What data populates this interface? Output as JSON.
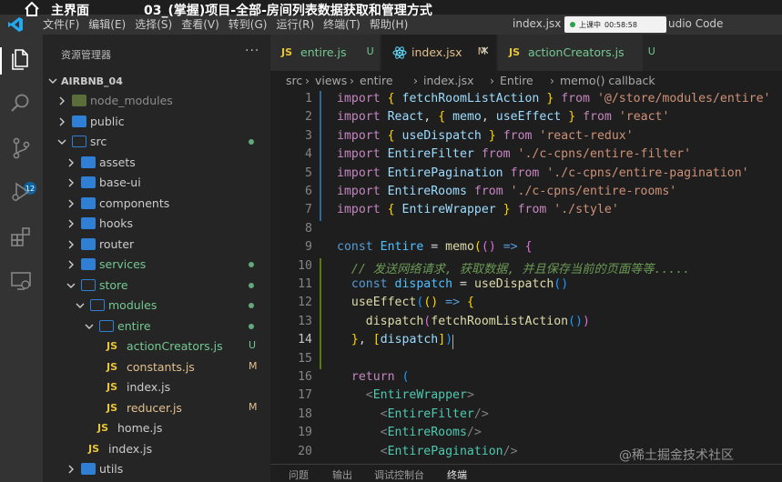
{
  "overlay": {
    "home_label": "主界面",
    "lesson_title": "03_(掌握)项目-全部-房间列表数据获取和管理方式"
  },
  "menu": [
    "文件(F)",
    "编辑(E)",
    "选择(S)",
    "查看(V)",
    "转到(G)",
    "运行(R)",
    "终端(T)",
    "帮助(H)"
  ],
  "window": {
    "title": "index.jsx - ",
    "title_suffix": "udio Code",
    "meeting_label": "上课中",
    "meeting_time": "00:58:58"
  },
  "activity": {
    "scm_badge": "12",
    "icons": [
      "files-icon",
      "search-icon",
      "source-control-icon",
      "run-debug-icon",
      "extensions-icon",
      "remote-explorer-icon"
    ]
  },
  "explorer": {
    "header": "资源管理器",
    "more": "···",
    "root": "AIRBNB_04",
    "tree": [
      {
        "name": "node_modules",
        "type": "folder",
        "depth": 1,
        "open": false,
        "status": "",
        "dim": true
      },
      {
        "name": "public",
        "type": "folder",
        "depth": 1,
        "open": false,
        "status": ""
      },
      {
        "name": "src",
        "type": "folder",
        "depth": 1,
        "open": true,
        "status": "dot"
      },
      {
        "name": "assets",
        "type": "folder",
        "depth": 2,
        "open": false,
        "status": ""
      },
      {
        "name": "base-ui",
        "type": "folder",
        "depth": 2,
        "open": false,
        "status": ""
      },
      {
        "name": "components",
        "type": "folder",
        "depth": 2,
        "open": false,
        "status": ""
      },
      {
        "name": "hooks",
        "type": "folder",
        "depth": 2,
        "open": false,
        "status": ""
      },
      {
        "name": "router",
        "type": "folder",
        "depth": 2,
        "open": false,
        "status": ""
      },
      {
        "name": "services",
        "type": "folder",
        "depth": 2,
        "open": false,
        "status": "dot",
        "color": "green"
      },
      {
        "name": "store",
        "type": "folder",
        "depth": 2,
        "open": true,
        "status": "dot",
        "color": "green"
      },
      {
        "name": "modules",
        "type": "folder",
        "depth": 3,
        "open": true,
        "status": "dot",
        "color": "green"
      },
      {
        "name": "entire",
        "type": "folder",
        "depth": 4,
        "open": true,
        "status": "dot",
        "color": "green"
      },
      {
        "name": "actionCreators.js",
        "type": "js",
        "depth": 5,
        "status": "U",
        "color": "green"
      },
      {
        "name": "constants.js",
        "type": "js",
        "depth": 5,
        "status": "M",
        "color": "yellow"
      },
      {
        "name": "index.js",
        "type": "js",
        "depth": 5,
        "status": ""
      },
      {
        "name": "reducer.js",
        "type": "js",
        "depth": 5,
        "status": "M",
        "color": "yellow"
      },
      {
        "name": "home.js",
        "type": "js",
        "depth": 4,
        "status": ""
      },
      {
        "name": "index.js",
        "type": "js",
        "depth": 3,
        "status": ""
      },
      {
        "name": "utils",
        "type": "folder",
        "depth": 2,
        "open": false,
        "status": ""
      }
    ]
  },
  "tabs": [
    {
      "name": "entire.js",
      "mod": "U",
      "icon": "js",
      "active": false
    },
    {
      "name": "index.jsx",
      "mod": "M",
      "icon": "react",
      "active": true
    },
    {
      "name": "actionCreators.js",
      "mod": "U",
      "icon": "js",
      "active": false
    }
  ],
  "breadcrumb": [
    "src",
    "views",
    "entire",
    "index.jsx",
    "Entire",
    "memo() callback"
  ],
  "panel_tabs": [
    "问题",
    "输出",
    "调试控制台",
    "终端"
  ],
  "watermark": "@稀土掘金技术社区"
}
